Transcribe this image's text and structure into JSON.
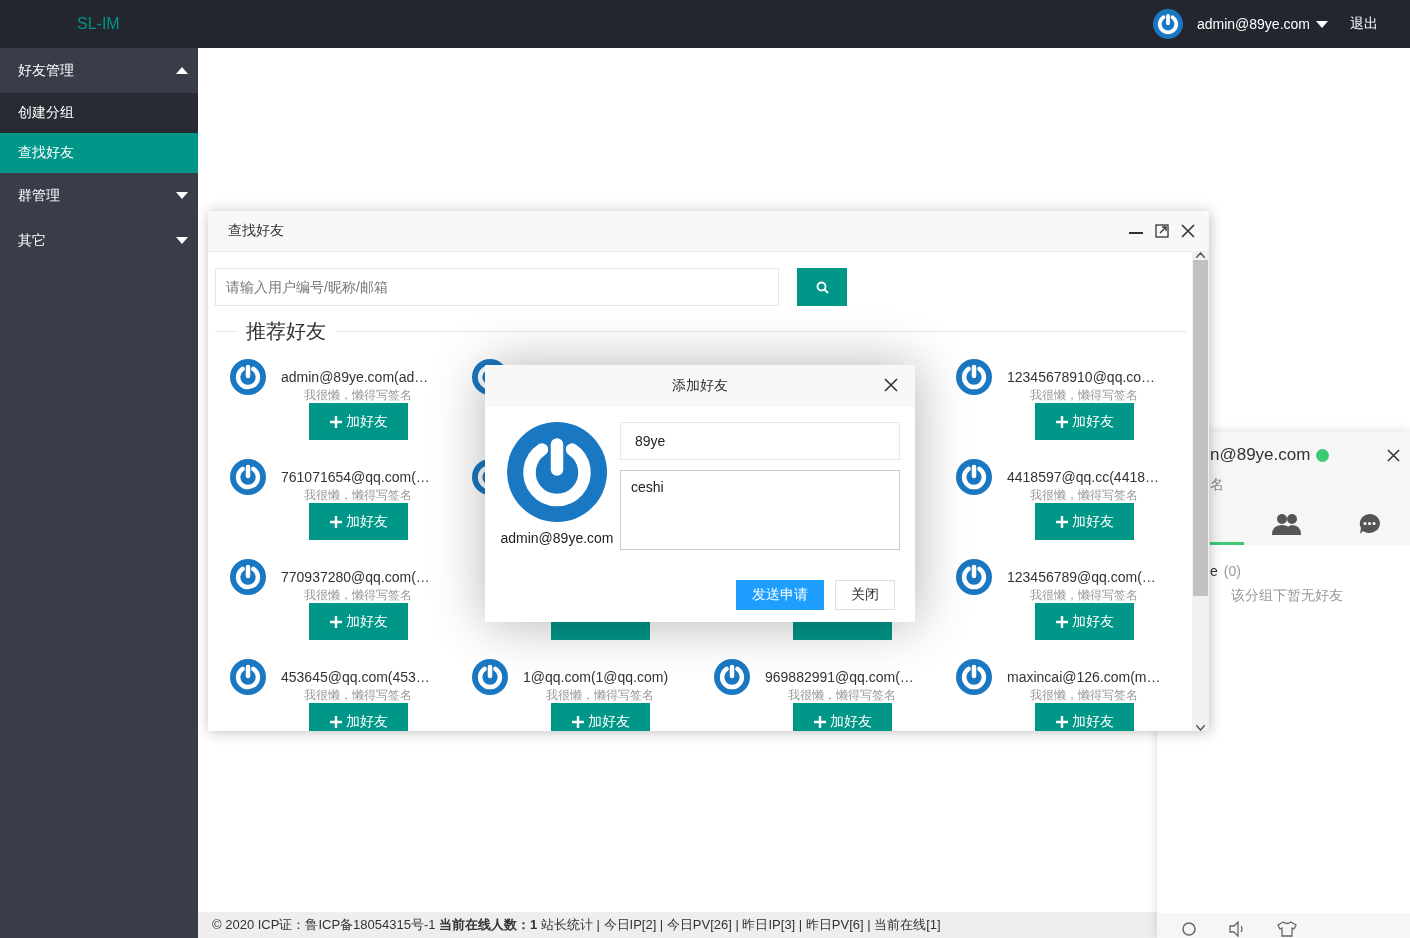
{
  "header": {
    "logo": "SL-IM",
    "user": "admin@89ye.com",
    "logout": "退出"
  },
  "sidebar": {
    "items": [
      {
        "label": "好友管理",
        "expanded": true,
        "children": [
          {
            "label": "创建分组",
            "selected": false
          },
          {
            "label": "查找好友",
            "selected": true
          }
        ]
      },
      {
        "label": "群管理",
        "expanded": false
      },
      {
        "label": "其它",
        "expanded": false
      }
    ]
  },
  "find_window": {
    "title": "查找好友",
    "search": {
      "placeholder": "请输入用户编号/昵称/邮箱"
    },
    "section_title": "推荐好友",
    "cards": [
      {
        "kind": "full",
        "name": "admin@89ye.com(ad…",
        "sign": "我很懒，懒得写签名",
        "button": "加好友"
      },
      {
        "kind": "avatar_only"
      },
      {
        "kind": "hidden"
      },
      {
        "kind": "full",
        "name": "12345678910@qq.co…",
        "sign": "我很懒，懒得写签名",
        "button": "加好友"
      },
      {
        "kind": "full",
        "name": "761071654@qq.com(…",
        "sign": "我很懒，懒得写签名",
        "button": "加好友"
      },
      {
        "kind": "avatar_only"
      },
      {
        "kind": "hidden"
      },
      {
        "kind": "full",
        "name": "4418597@qq.cc(4418…",
        "sign": "我很懒，懒得写签名",
        "button": "加好友"
      },
      {
        "kind": "full",
        "name": "770937280@qq.com(…",
        "sign": "我很懒，懒得写签名",
        "button": "加好友"
      },
      {
        "kind": "button_only"
      },
      {
        "kind": "button_only"
      },
      {
        "kind": "full",
        "name": "123456789@qq.com(…",
        "sign": "我很懒，懒得写签名",
        "button": "加好友"
      },
      {
        "kind": "full",
        "name": "453645@qq.com(453…",
        "sign": "我很懒，懒得写签名",
        "button": "加好友"
      },
      {
        "kind": "full",
        "name": "1@qq.com(1@qq.com)",
        "sign": "我很懒，懒得写签名",
        "button": "加好友"
      },
      {
        "kind": "full",
        "name": "969882991@qq.com(…",
        "sign": "我很懒，懒得写签名",
        "button": "加好友"
      },
      {
        "kind": "full",
        "name": "maxincai@126.com(m…",
        "sign": "我很懒，懒得写签名",
        "button": "加好友"
      }
    ]
  },
  "add_dialog": {
    "title": "添加好友",
    "user": "admin@89ye.com",
    "group_value": "89ye",
    "message_value": "ceshi",
    "buttons": [
      {
        "label": "发送申请",
        "kind": "primary"
      },
      {
        "label": "关闭",
        "kind": "plain"
      }
    ]
  },
  "chat_panel": {
    "name": "n@89ye.com",
    "online": true,
    "sign": "名",
    "tabs": [
      {
        "kind": "friends",
        "selected": true
      },
      {
        "kind": "groups",
        "selected": false
      },
      {
        "kind": "history",
        "selected": false
      }
    ],
    "group": {
      "name": "e",
      "count": "(0)",
      "empty": "该分组下暂无好友"
    }
  },
  "footer": {
    "text": "© 2020 ICP证：鲁ICP备18054315号-1 **当前在线人数：1** 站长统计 | 今日IP[2] | 今日PV[26] | 昨日IP[3] | 昨日PV[6] | 当前在线[1]"
  }
}
